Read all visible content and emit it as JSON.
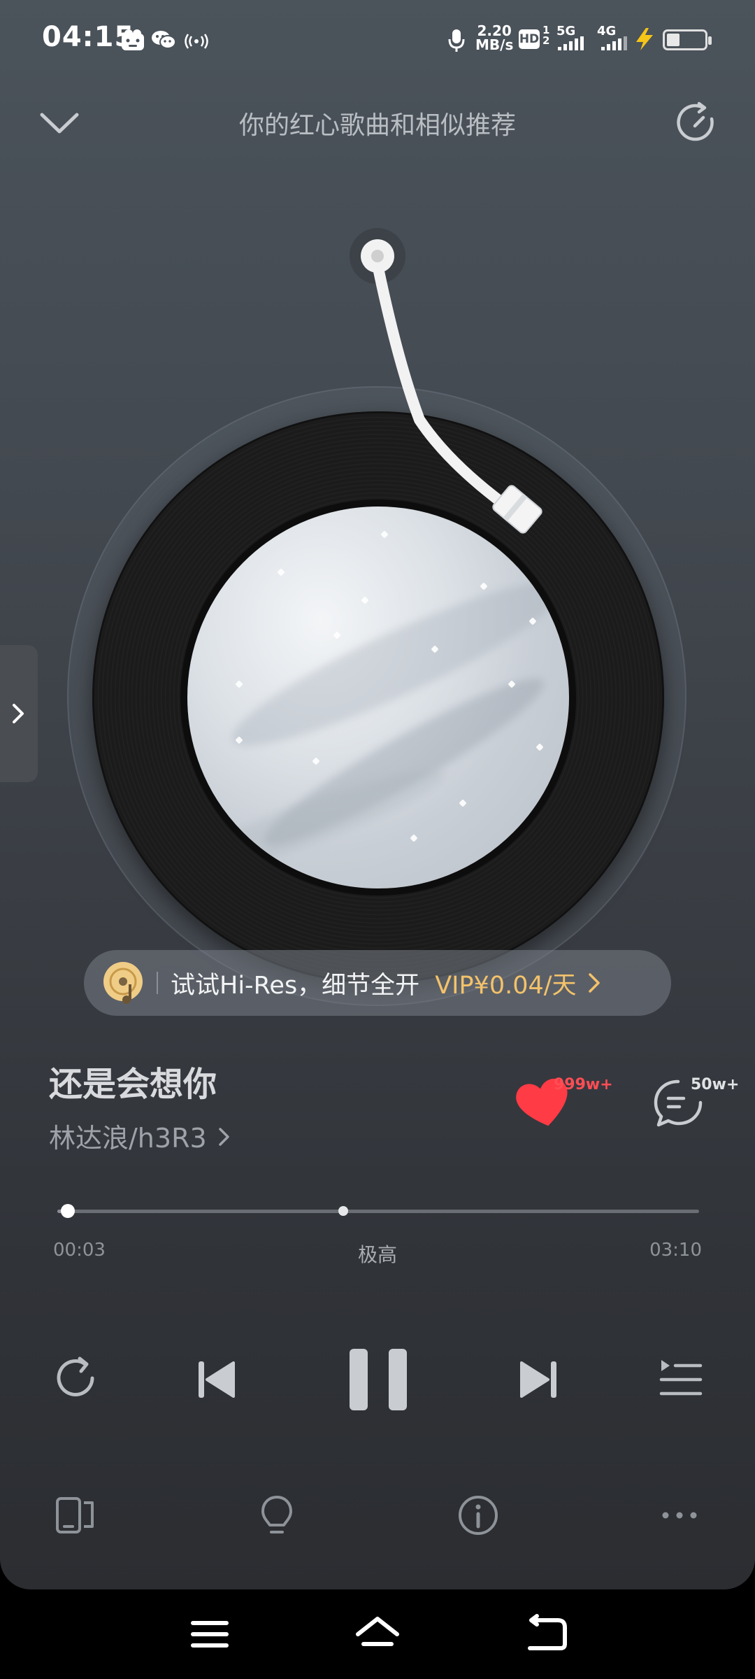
{
  "status_bar": {
    "time": "04:15",
    "net_speed_value": "2.20",
    "net_speed_unit": "MB/s",
    "hd_label": "HD",
    "sim1_label": "5G",
    "sim2_label": "4G",
    "battery_level": 0.35,
    "icons": [
      "cloud-app-icon",
      "wechat-icon",
      "hotspot-icon",
      "mic-icon",
      "hd-icon",
      "signal-5g-icon",
      "signal-4g-icon",
      "charging-icon",
      "battery-icon"
    ]
  },
  "header": {
    "title": "你的红心歌曲和相似推荐",
    "collapse_icon": "chevron-down-icon",
    "refresh_icon": "refresh-icon"
  },
  "banner": {
    "text": "试试Hi-Res，细节全开",
    "vip_text": "VIP¥0.04/天",
    "icon": "hires-disc-icon"
  },
  "song": {
    "title": "还是会想你",
    "artist": "林达浪/h3R3",
    "like_count": "999w+",
    "comment_count": "50w+"
  },
  "progress": {
    "current": "00:03",
    "total": "03:10",
    "quality": "极高",
    "fraction": 0.016
  },
  "colors": {
    "accent_red": "#ff3b45",
    "vip_gold": "#f3c26a"
  },
  "controls": [
    "repeat-icon",
    "previous-icon",
    "pause-icon",
    "next-icon",
    "playlist-icon"
  ],
  "bottom_bar": [
    "device-icon",
    "lightbulb-icon",
    "info-icon",
    "more-icon"
  ],
  "nav_bar": [
    "menu-icon",
    "home-icon",
    "back-icon"
  ]
}
